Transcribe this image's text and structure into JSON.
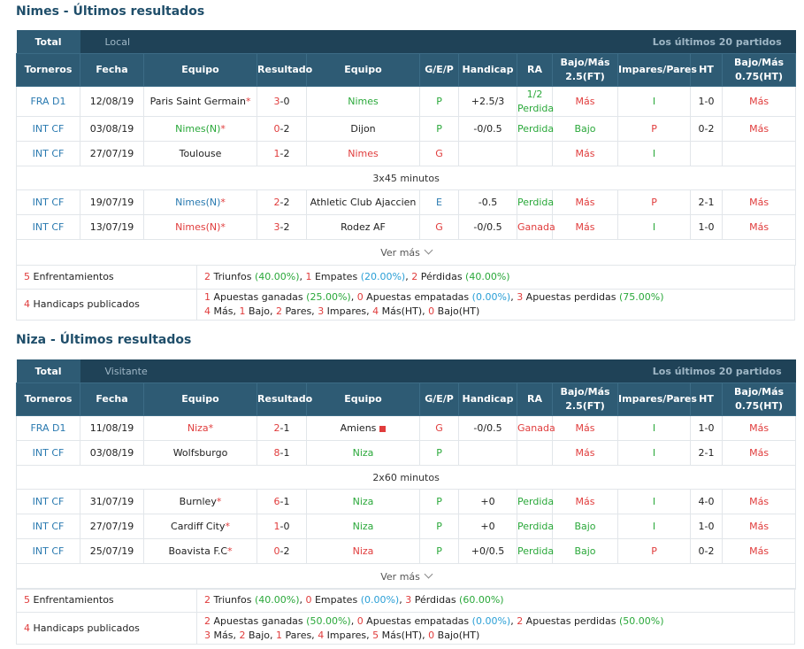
{
  "nimes": {
    "title": "Nimes - Últimos resultados",
    "tabs": {
      "total": "Total",
      "other": "Local",
      "right": "Los últimos 20 partidos"
    },
    "headers": [
      "Torneros",
      "Fecha",
      "Equipo",
      "Resultado",
      "Equipo",
      "G/E/P",
      "Handicap",
      "RA",
      "Bajo/Más 2.5(FT)",
      "Impares/Pares",
      "HT",
      "Bajo/Más 0.75(HT)"
    ],
    "rows": [
      {
        "league": "FRA D1",
        "date": "12/08/19",
        "home": "Paris Saint Germain",
        "home_star": "*",
        "r1": "3",
        "r2": "-0",
        "away": "Nimes",
        "gep": "P",
        "hcp": "+2.5/3",
        "ra": "1/2\nPerdida",
        "ou": "Más",
        "oe": "I",
        "ht": "1-0",
        "ou2": "Más"
      },
      {
        "league": "INT CF",
        "date": "03/08/19",
        "home": "Nimes(N)",
        "home_star": "*",
        "r1": "0",
        "r2": "-2",
        "away": "Dijon",
        "gep": "P",
        "hcp": "-0/0.5",
        "ra": "Perdida",
        "ou": "Bajo",
        "oe": "P",
        "ht": "0-2",
        "ou2": "Más"
      },
      {
        "league": "INT CF",
        "date": "27/07/19",
        "home": "Toulouse",
        "home_star": "",
        "r1": "1",
        "r2": "-2",
        "away": "Nimes",
        "gep": "G",
        "hcp": "",
        "ra": "",
        "ou": "Más",
        "oe": "I",
        "ht": "",
        "ou2": ""
      }
    ],
    "note": "3x45 minutos",
    "rows2": [
      {
        "league": "INT CF",
        "date": "19/07/19",
        "home": "Nimes(N)",
        "home_star": "*",
        "r1": "2",
        "r2": "-2",
        "away": "Athletic Club Ajaccien",
        "gep": "E",
        "hcp": "-0.5",
        "ra": "Perdida",
        "ou": "Más",
        "oe": "P",
        "ht": "2-1",
        "ou2": "Más"
      },
      {
        "league": "INT CF",
        "date": "13/07/19",
        "home": "Nimes(N)",
        "home_star": "*",
        "r1": "3",
        "r2": "-2",
        "away": "Rodez AF",
        "gep": "G",
        "hcp": "-0/0.5",
        "ra": "Ganada",
        "ou": "Más",
        "oe": "I",
        "ht": "1-0",
        "ou2": "Más"
      }
    ],
    "more": "Ver más",
    "summary": {
      "enf_n": "5",
      "enf_label": " Enfrentamientos",
      "hcp_n": "4",
      "hcp_label": " Handicaps publicados",
      "line1": [
        "2",
        " Triunfos ",
        "(40.00%)",
        ", ",
        "1",
        " Empates ",
        "(20.00%)",
        ", ",
        "2",
        " Pérdidas ",
        "(40.00%)"
      ],
      "line2": [
        "1",
        " Apuestas ganadas ",
        "(25.00%)",
        ", ",
        "0",
        " Apuestas empatadas ",
        "(0.00%)",
        ", ",
        "3",
        " Apuestas perdidas ",
        "(75.00%)"
      ],
      "line3": [
        "4",
        " Más, ",
        "1",
        " Bajo, ",
        "2",
        " Pares, ",
        "3",
        " Impares, ",
        "4",
        " Más(HT), ",
        "0",
        " Bajo(HT)"
      ]
    }
  },
  "niza": {
    "title": "Niza - Últimos resultados",
    "tabs": {
      "total": "Total",
      "other": "Visitante",
      "right": "Los últimos 20 partidos"
    },
    "rows": [
      {
        "league": "FRA D1",
        "date": "11/08/19",
        "home": "Niza",
        "home_star": "*",
        "r1": "2",
        "r2": "-1",
        "away": "Amiens",
        "gep": "G",
        "hcp": "-0/0.5",
        "ra": "Ganada",
        "ou": "Más",
        "oe": "I",
        "ht": "1-0",
        "ou2": "Más"
      },
      {
        "league": "INT CF",
        "date": "03/08/19",
        "home": "Wolfsburgo",
        "home_star": "",
        "r1": "8",
        "r2": "-1",
        "away": "Niza",
        "gep": "P",
        "hcp": "",
        "ra": "",
        "ou": "Más",
        "oe": "I",
        "ht": "2-1",
        "ou2": "Más"
      }
    ],
    "note": "2x60 minutos",
    "rows2": [
      {
        "league": "INT CF",
        "date": "31/07/19",
        "home": "Burnley",
        "home_star": "*",
        "r1": "6",
        "r2": "-1",
        "away": "Niza",
        "gep": "P",
        "hcp": "+0",
        "ra": "Perdida",
        "ou": "Más",
        "oe": "I",
        "ht": "4-0",
        "ou2": "Más"
      },
      {
        "league": "INT CF",
        "date": "27/07/19",
        "home": "Cardiff City",
        "home_star": "*",
        "r1": "1",
        "r2": "-0",
        "away": "Niza",
        "gep": "P",
        "hcp": "+0",
        "ra": "Perdida",
        "ou": "Bajo",
        "oe": "I",
        "ht": "1-0",
        "ou2": "Más"
      },
      {
        "league": "INT CF",
        "date": "25/07/19",
        "home": "Boavista F.C",
        "home_star": "*",
        "r1": "0",
        "r2": "-2",
        "away": "Niza",
        "gep": "P",
        "hcp": "+0/0.5",
        "ra": "Perdida",
        "ou": "Bajo",
        "oe": "P",
        "ht": "0-2",
        "ou2": "Más"
      }
    ],
    "more": "Ver más",
    "summary": {
      "enf_n": "5",
      "enf_label": " Enfrentamientos",
      "hcp_n": "4",
      "hcp_label": " Handicaps publicados",
      "line1": [
        "2",
        " Triunfos ",
        "(40.00%)",
        ", ",
        "0",
        " Empates ",
        "(0.00%)",
        ", ",
        "3",
        " Pérdidas ",
        "(60.00%)"
      ],
      "line2": [
        "2",
        " Apuestas ganadas ",
        "(50.00%)",
        ", ",
        "0",
        " Apuestas empatadas ",
        "(0.00%)",
        ", ",
        "2",
        " Apuestas perdidas ",
        "(50.00%)"
      ],
      "line3": [
        "3",
        " Más, ",
        "2",
        " Bajo, ",
        "1",
        " Pares, ",
        "4",
        " Impares, ",
        "5",
        " Más(HT), ",
        "0",
        " Bajo(HT)"
      ]
    }
  }
}
